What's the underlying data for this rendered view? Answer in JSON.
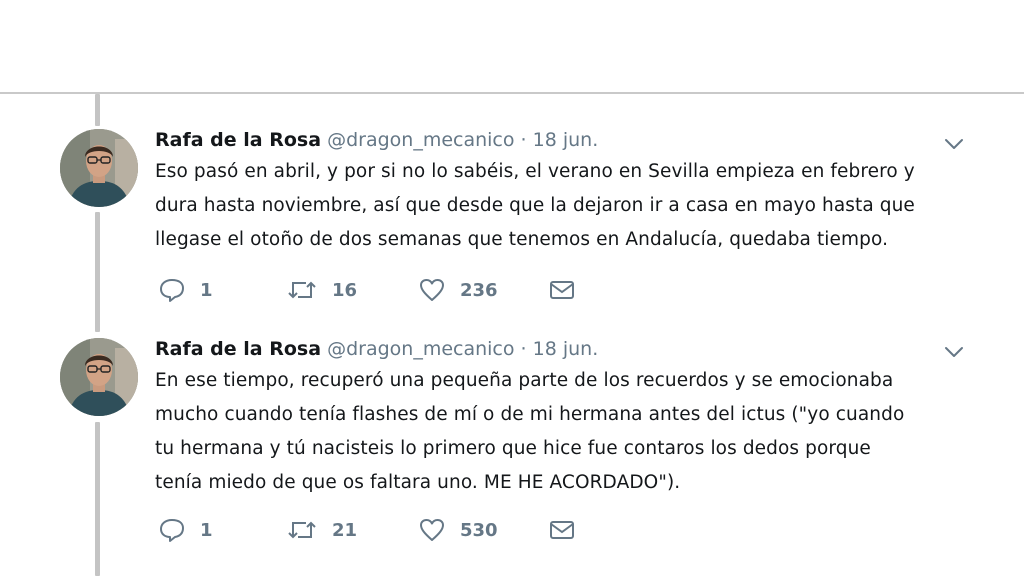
{
  "tweets": [
    {
      "name": "Rafa de la Rosa",
      "handle": "@dragon_mecanico",
      "separator": "·",
      "date": "18 jun.",
      "text": "Eso pasó en abril, y por si no lo sabéis, el verano en Sevilla empieza en febrero y\ndura hasta noviembre, así que desde que la dejaron ir a casa en mayo hasta que\nllegase el otoño de dos semanas que tenemos en Andalucía, quedaba tiempo.",
      "replies": "1",
      "retweets": "16",
      "likes": "236"
    },
    {
      "name": "Rafa de la Rosa",
      "handle": "@dragon_mecanico",
      "separator": "·",
      "date": "18 jun.",
      "text": "En ese tiempo, recuperó una pequeña parte de los recuerdos y se emocionaba\nmucho cuando tenía flashes de mí o de mi hermana antes del ictus (\"yo cuando\ntu hermana y tú nacisteis lo primero que hice fue contaros los dedos porque\ntenía miedo de que os faltara uno. ME HE ACORDADO\").",
      "replies": "1",
      "retweets": "21",
      "likes": "530"
    }
  ],
  "icons": {
    "reply": "reply-icon",
    "retweet": "retweet-icon",
    "like": "heart-icon",
    "message": "envelope-icon",
    "menu": "chevron-down-icon"
  },
  "colors": {
    "text": "#14171a",
    "secondary": "#657786",
    "thread_line": "#c4c4c4",
    "divider": "#c9c9c9"
  }
}
